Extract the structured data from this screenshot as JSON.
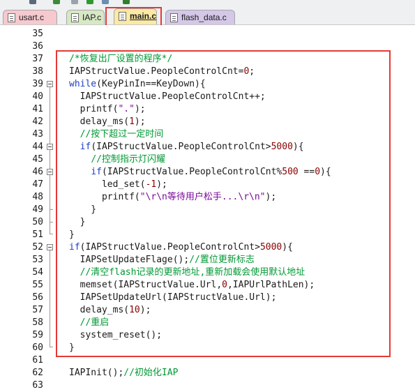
{
  "tabs": [
    {
      "label": "usart.c",
      "active": false
    },
    {
      "label": "IAP.c",
      "active": false
    },
    {
      "label": "main.c",
      "active": true
    },
    {
      "label": "flash_data.c",
      "active": false
    }
  ],
  "lines": [
    {
      "num": "35",
      "code": ""
    },
    {
      "num": "36",
      "code": ""
    },
    {
      "num": "37",
      "code": "/*恢复出厂设置的程序*/"
    },
    {
      "num": "38",
      "code": "IAPStructValue.PeopleControlCnt=0;"
    },
    {
      "num": "39",
      "code": "while(KeyPinIn==KeyDown){"
    },
    {
      "num": "40",
      "code": "  IAPStructValue.PeopleControlCnt++;"
    },
    {
      "num": "41",
      "code": "  printf(\".\");"
    },
    {
      "num": "42",
      "code": "  delay_ms(1);"
    },
    {
      "num": "43",
      "code": "  //按下超过一定时间"
    },
    {
      "num": "44",
      "code": "  if(IAPStructValue.PeopleControlCnt>5000){"
    },
    {
      "num": "45",
      "code": "    //控制指示灯闪耀"
    },
    {
      "num": "46",
      "code": "    if(IAPStructValue.PeopleControlCnt%500 ==0){"
    },
    {
      "num": "47",
      "code": "      led_set(-1);"
    },
    {
      "num": "48",
      "code": "      printf(\"\\r\\n等待用户松手...\\r\\n\");"
    },
    {
      "num": "49",
      "code": "    }"
    },
    {
      "num": "50",
      "code": "  }"
    },
    {
      "num": "51",
      "code": "}"
    },
    {
      "num": "52",
      "code": "if(IAPStructValue.PeopleControlCnt>5000){"
    },
    {
      "num": "53",
      "code": "  IAPSetUpdateFlage();//置位更新标志"
    },
    {
      "num": "54",
      "code": "  //清空flash记录的更新地址,重新加载会使用默认地址"
    },
    {
      "num": "55",
      "code": "  memset(IAPStructValue.Url,0,IAPUrlPathLen);"
    },
    {
      "num": "56",
      "code": "  IAPSetUpdateUrl(IAPStructValue.Url);"
    },
    {
      "num": "57",
      "code": "  delay_ms(10);"
    },
    {
      "num": "58",
      "code": "  //重启"
    },
    {
      "num": "59",
      "code": "  system_reset();"
    },
    {
      "num": "60",
      "code": "}"
    },
    {
      "num": "61",
      "code": ""
    },
    {
      "num": "62",
      "code": "IAPInit();//初始化IAP"
    },
    {
      "num": "63",
      "code": ""
    }
  ],
  "colors": {
    "keyword": "#1f3dc4",
    "comment": "#009933",
    "number": "#8b0000",
    "string": "#7a0a99",
    "highlight": "#e53935"
  },
  "icons": [
    "file-c-icon",
    "fold-minus-icon"
  ]
}
